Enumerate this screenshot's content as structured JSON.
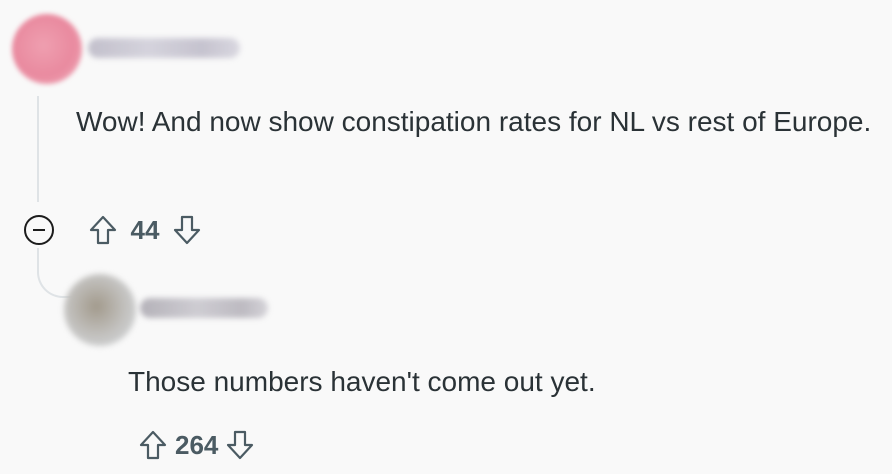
{
  "comments": [
    {
      "body": "Wow! And now show constipation rates for NL vs rest of Europe.",
      "score": "44"
    },
    {
      "body": "Those numbers haven't come out yet.",
      "score": "264"
    }
  ],
  "icons": {
    "collapse": "minus-circle-icon",
    "upvote": "arrow-up-outline-icon",
    "downvote": "arrow-down-outline-icon"
  },
  "colors": {
    "background": "#f9f9f9",
    "text": "#2a3236",
    "score": "#4b5b63",
    "thread_line": "#dfe3e6"
  }
}
